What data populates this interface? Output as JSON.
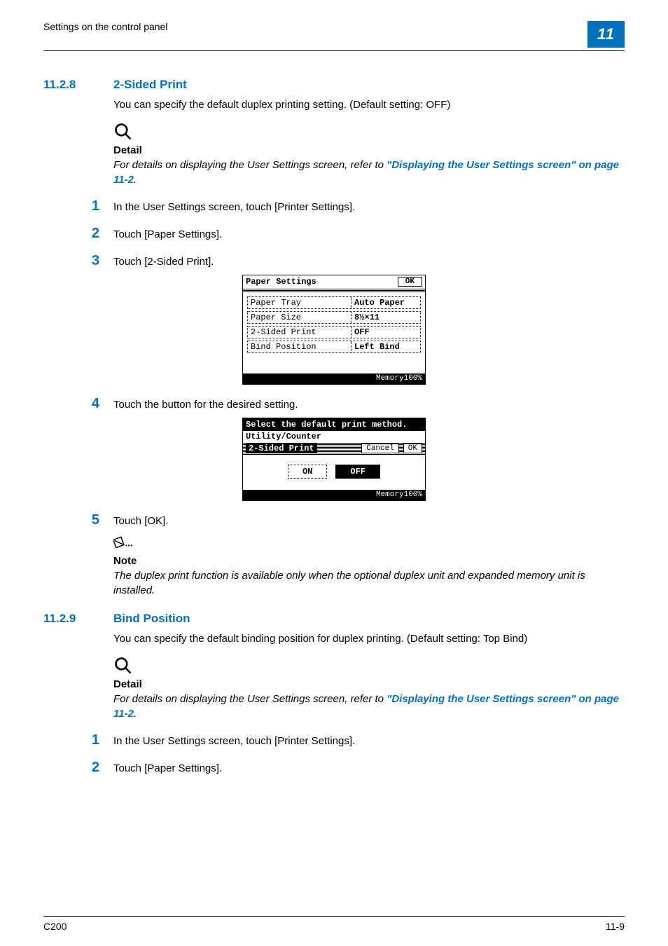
{
  "header": {
    "running_title": "Settings on the control panel",
    "chapter_number": "11"
  },
  "sections": {
    "s1": {
      "number": "11.2.8",
      "title": "2-Sided Print",
      "intro": "You can specify the default duplex printing setting. (Default setting: OFF)",
      "detail": {
        "label": "Detail",
        "text": "For details on displaying the User Settings screen, refer to ",
        "link": "\"Displaying the User Settings screen\" on page 11-2",
        "suffix": "."
      },
      "steps": {
        "1": "In the User Settings screen, touch [Printer Settings].",
        "2": "Touch [Paper Settings].",
        "3": "Touch [2-Sided Print].",
        "4": "Touch the button for the desired setting.",
        "5": "Touch [OK]."
      },
      "note": {
        "label": "Note",
        "text": "The duplex print function is available only when the optional duplex unit and expanded memory unit is installed."
      }
    },
    "s2": {
      "number": "11.2.9",
      "title": "Bind Position",
      "intro": "You can specify the default binding position for duplex printing. (Default setting: Top Bind)",
      "detail": {
        "label": "Detail",
        "text": "For details on displaying the User Settings screen, refer to ",
        "link": "\"Displaying the User Settings screen\" on page 11-2",
        "suffix": "."
      },
      "steps": {
        "1": "In the User Settings screen, touch [Printer Settings].",
        "2": "Touch [Paper Settings]."
      }
    }
  },
  "lcd1": {
    "title": "Paper Settings",
    "ok": "OK",
    "rows": [
      {
        "label": "Paper Tray",
        "value": "Auto Paper"
      },
      {
        "label": "Paper Size",
        "value": "8½×11"
      },
      {
        "label": "2-Sided Print",
        "value": "OFF"
      },
      {
        "label": "Bind Position",
        "value": "Left Bind"
      }
    ],
    "memory": "Memory100%"
  },
  "lcd2": {
    "top_instruction": "Select the default print method.",
    "crumb": "Utility/Counter",
    "sub_title": "2-Sided Print",
    "cancel": "Cancel",
    "ok": "OK",
    "on": "ON",
    "off": "OFF",
    "memory": "Memory100%"
  },
  "footer": {
    "model": "C200",
    "page": "11-9"
  }
}
